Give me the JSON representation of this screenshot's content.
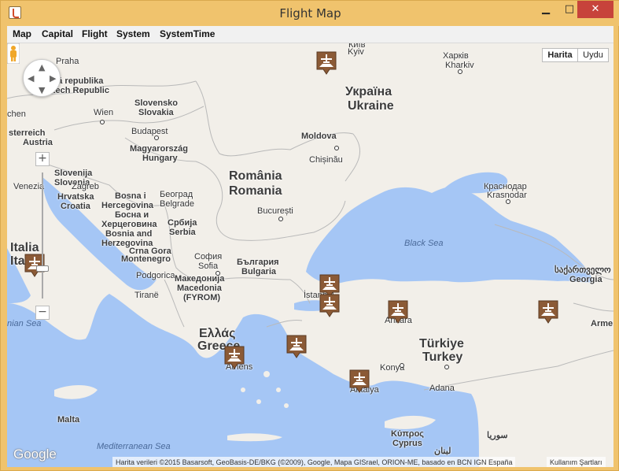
{
  "window": {
    "title": "Flight Map",
    "minimize_glyph": "▁",
    "maximize_glyph": "□",
    "close_glyph": "✕"
  },
  "menu": [
    "Map",
    "Capital",
    "Flight",
    "System",
    "SystemTime"
  ],
  "map_type": {
    "map": "Harita",
    "satellite": "Uydu",
    "selected": "Harita"
  },
  "zoom": {
    "in": "+",
    "out": "−"
  },
  "logo": "Google",
  "attribution": "Harita verileri ©2015 Basarsoft, GeoBasis-DE/BKG (©2009), Google, Mapa GISrael, ORION-ME, basado en BCN IGN España",
  "terms": "Kullanım Şartları",
  "labels": {
    "praha": "Praha",
    "ceska": "ská republika",
    "czech": "zech Republic",
    "slovensko": "Slovensko",
    "slovakia": "Slovakia",
    "wien": "Wien",
    "chen": "chen",
    "osterreich": "sterreich",
    "austria": "Austria",
    "budapest": "Budapest",
    "magyarorszag": "Magyarország",
    "hungary": "Hungary",
    "slovenija": "Slovenija",
    "slovenia": "Slovenia",
    "venezia": "Venezia",
    "zagreb": "Zagreb",
    "hrvatska": "Hrvatska",
    "croatia": "Croatia",
    "bosna_i": "Bosna i",
    "hercegovina": "Hercegovina",
    "bosna_cyr": "Босна и",
    "herc_cyr": "Херцеговина",
    "bosnia_and": "Bosnia and",
    "herzegovina": "Herzegovina",
    "beograd_cyr": "Београд",
    "beograd": "Belgrade",
    "srbija_cyr": "Србија",
    "serbia": "Serbia",
    "crna_gora": "Crna Gora",
    "montenegro": "Montenegro",
    "podgorica": "Podgorica",
    "tirane": "Tiranë",
    "sofia_cyr": "София",
    "sofia": "Sofia",
    "bulgaria_cyr": "България",
    "bulgaria": "Bulgaria",
    "makedonija": "Македонија",
    "macedonia": "Macedonia",
    "fyrom": "(FYROM)",
    "romania_ro": "România",
    "romania": "Romania",
    "bucuresti": "București",
    "moldova": "Moldova",
    "chisinau": "Chișinău",
    "kyiv_cyr": "Київ",
    "kyiv": "Kyiv",
    "ukraina": "Україна",
    "ukraine": "Ukraine",
    "kharkiv_cyr": "Харків",
    "kharkiv": "Kharkiv",
    "krasnodar_cyr": "Краснодар",
    "krasnodar": "Krasnodar",
    "black_sea": "Black Sea",
    "georgia_geo": "საქართველო",
    "georgia": "Georgia",
    "armenia": "Arme",
    "italia": "Italia",
    "italy": "Italy",
    "ionian_sea": "nian Sea",
    "ellada": "Ελλάς",
    "greece": "Greece",
    "athens": "Athens",
    "istanbul": "İstanbul",
    "ankara": "Ankara",
    "turkiye": "Türkiye",
    "turkey": "Turkey",
    "konya": "Konya",
    "antalya": "Antalya",
    "adana": "Adana",
    "kibris": "Κύπρος",
    "cyprus": "Cyprus",
    "syria": "سوريا",
    "lebanon": "لبنان",
    "malta": "Malta",
    "med_sea": "Mediterranean Sea"
  },
  "markers": [
    {
      "airport": "Kyiv"
    },
    {
      "airport": "Rome"
    },
    {
      "airport": "İstanbul 1"
    },
    {
      "airport": "İstanbul 2"
    },
    {
      "airport": "Ankara"
    },
    {
      "airport": "Izmir"
    },
    {
      "airport": "Athens"
    },
    {
      "airport": "Antalya"
    },
    {
      "airport": "Erzurum"
    }
  ],
  "colors": {
    "sea": "#a5c6f5",
    "land": "#f2efe9",
    "marker": "#8b5a36",
    "border": "#c0c0c0"
  }
}
